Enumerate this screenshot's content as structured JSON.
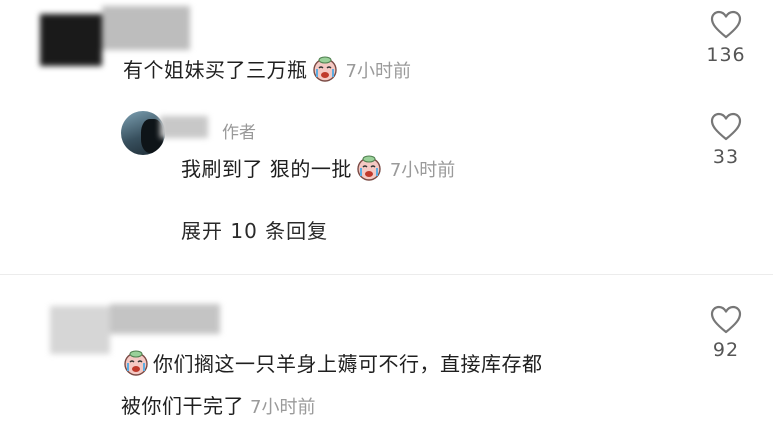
{
  "comments": [
    {
      "text": "有个姐妹买了三万瓶",
      "emoji": "crying-face-emoji",
      "time": "7小时前",
      "likes": "136"
    },
    {
      "author_tag": "作者",
      "text": "我刷到了 狠的一批",
      "emoji": "crying-face-emoji",
      "time": "7小时前",
      "likes": "33",
      "expand_label": "展开 10 条回复"
    },
    {
      "text_line1": "你们搁这一只羊身上薅可不行，直接库存都",
      "text_line2": "被你们干完了",
      "emoji": "crying-face-emoji",
      "time": "7小时前",
      "likes": "92"
    }
  ],
  "colors": {
    "text": "#1f1f1f",
    "time": "#9a9a9a",
    "count": "#555555",
    "icon": "#777777"
  }
}
